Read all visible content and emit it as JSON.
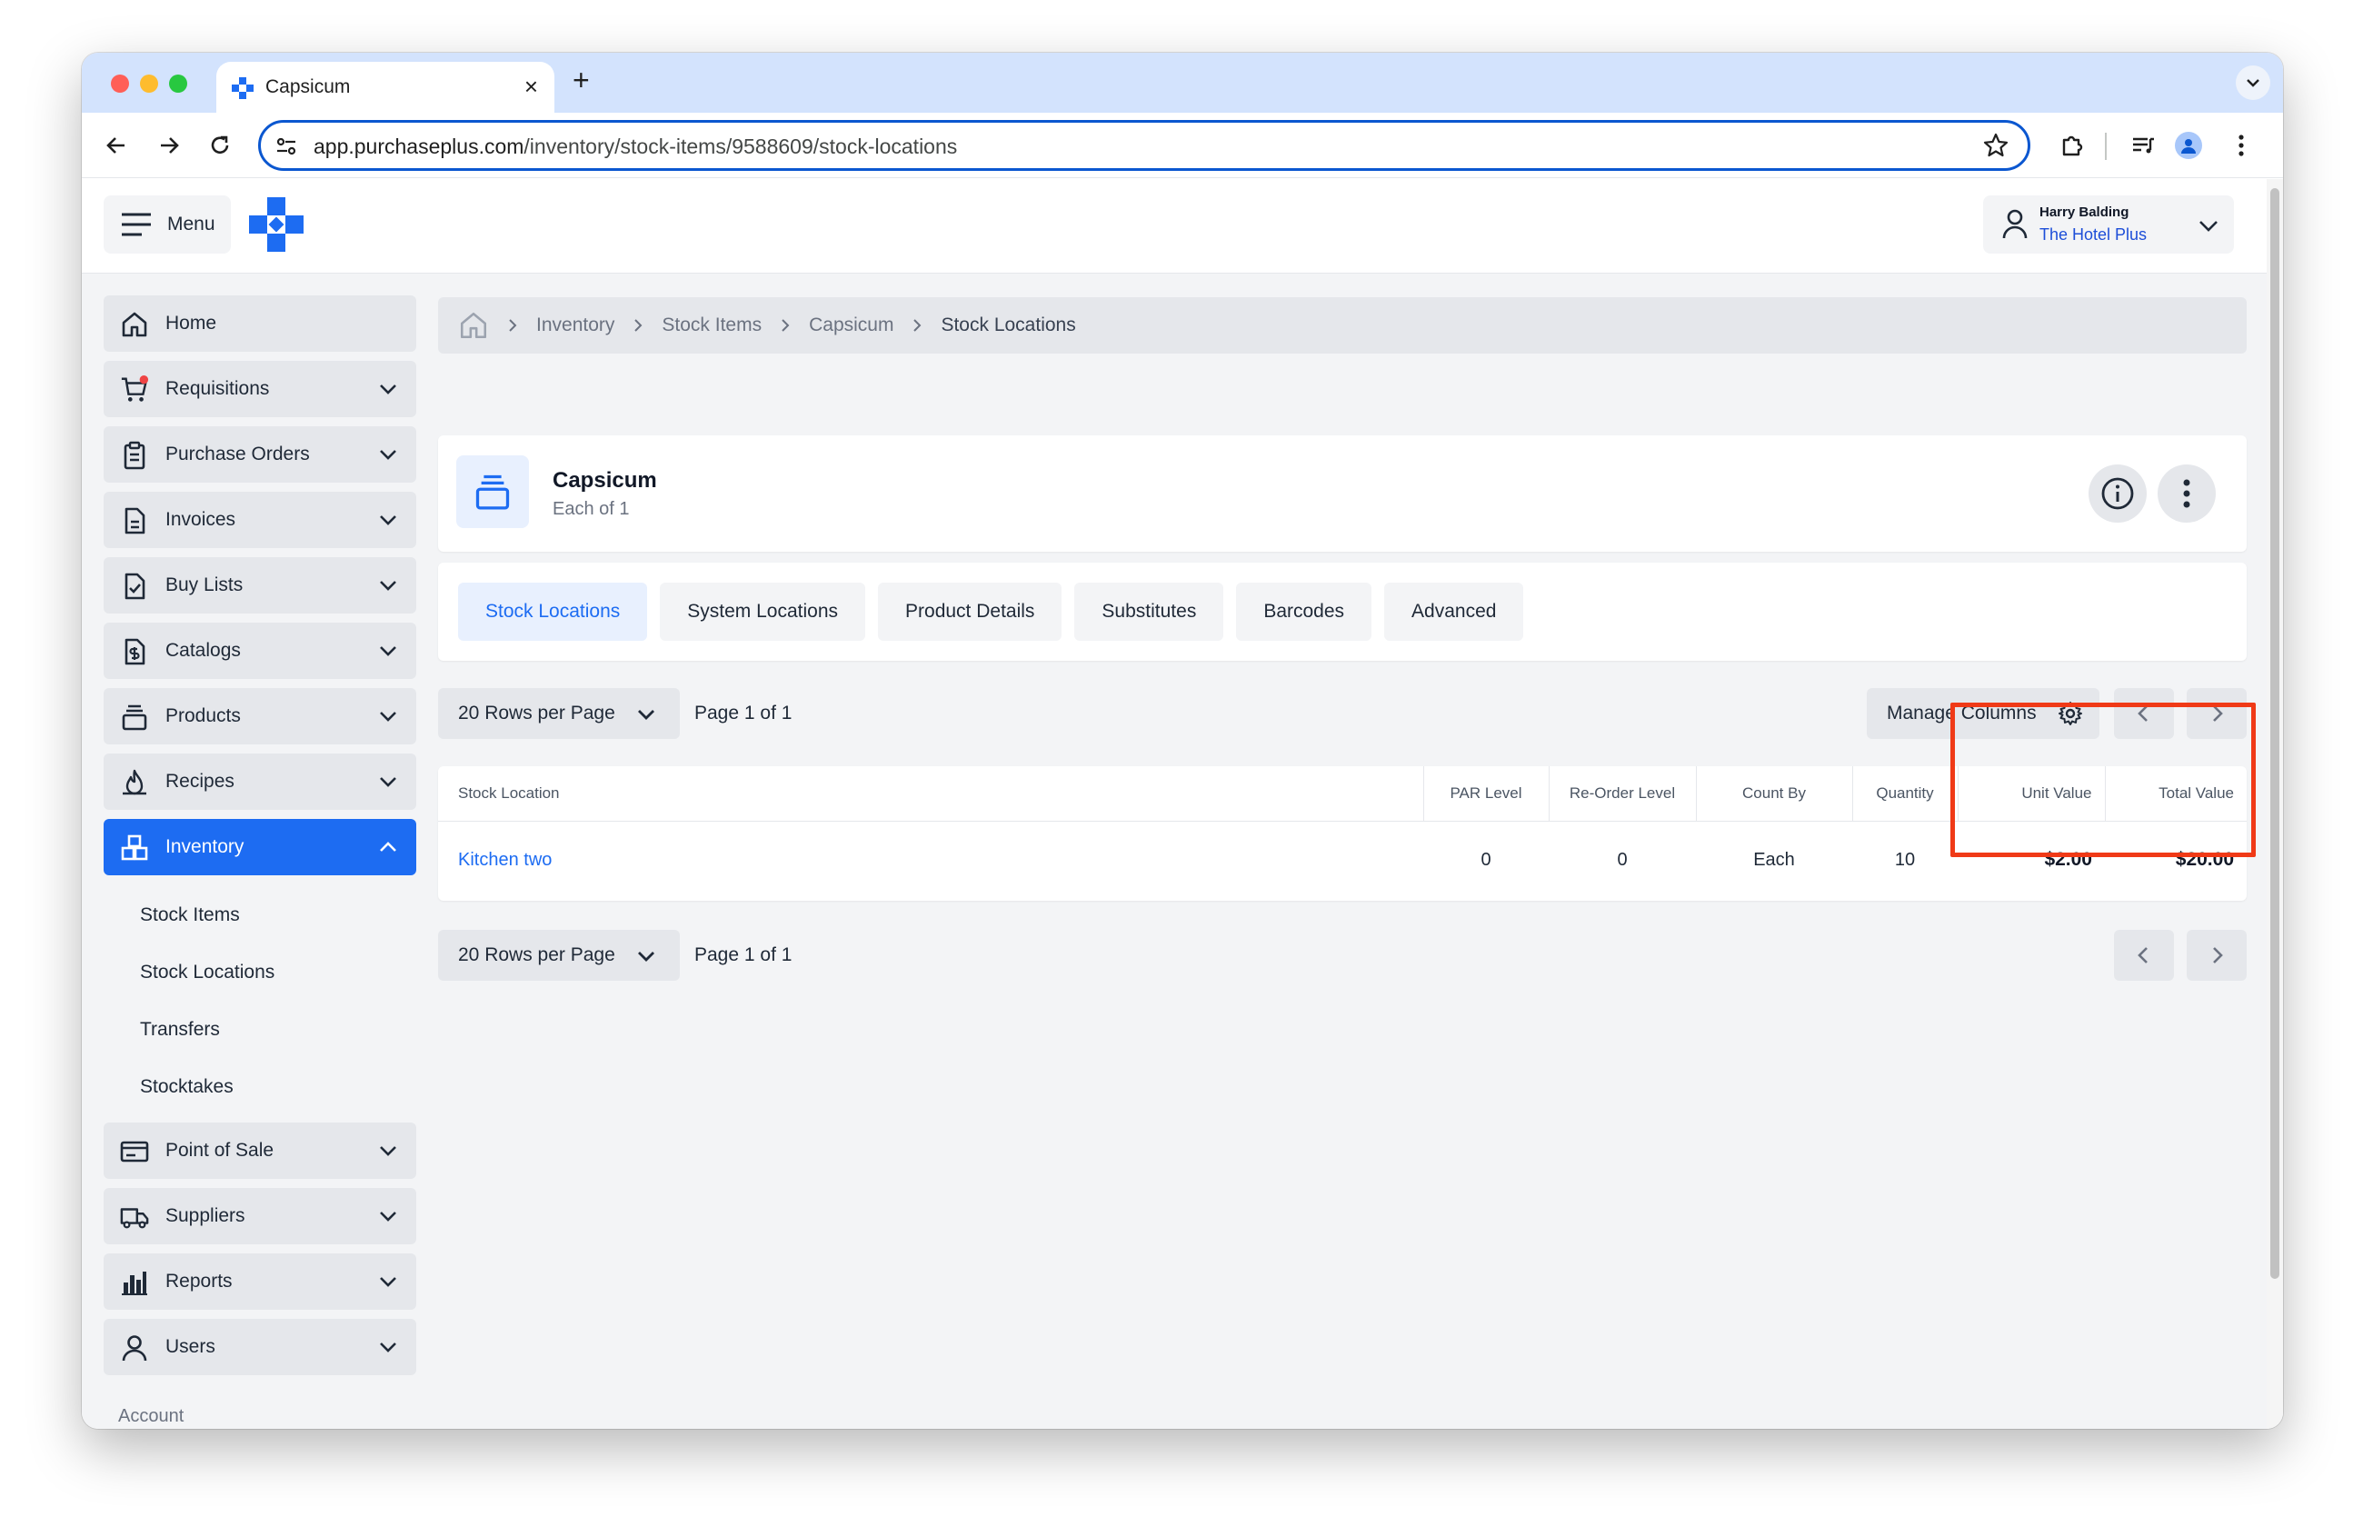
{
  "browser": {
    "tab_title": "Capsicum",
    "new_tab_symbol": "+",
    "close_symbol": "×",
    "url_host": "app.purchaseplus.com",
    "url_path": "/inventory/stock-items/9588609/stock-locations"
  },
  "header": {
    "menu_label": "Menu",
    "user_name": "Harry Balding",
    "user_org": "The Hotel Plus"
  },
  "sidebar": {
    "items": [
      {
        "label": "Home",
        "icon": "home-icon"
      },
      {
        "label": "Requisitions",
        "icon": "cart-icon"
      },
      {
        "label": "Purchase Orders",
        "icon": "clipboard-icon"
      },
      {
        "label": "Invoices",
        "icon": "document-icon"
      },
      {
        "label": "Buy Lists",
        "icon": "checklist-icon"
      },
      {
        "label": "Catalogs",
        "icon": "dollar-doc-icon"
      },
      {
        "label": "Products",
        "icon": "stack-icon"
      },
      {
        "label": "Recipes",
        "icon": "flame-icon"
      },
      {
        "label": "Inventory",
        "icon": "boxes-icon"
      },
      {
        "label": "Point of Sale",
        "icon": "card-icon"
      },
      {
        "label": "Suppliers",
        "icon": "truck-icon"
      },
      {
        "label": "Reports",
        "icon": "bar-chart-icon"
      },
      {
        "label": "Users",
        "icon": "user-icon"
      }
    ],
    "inventory_sub": [
      "Stock Items",
      "Stock Locations",
      "Transfers",
      "Stocktakes"
    ],
    "account_label": "Account"
  },
  "breadcrumb": [
    "Inventory",
    "Stock Items",
    "Capsicum",
    "Stock Locations"
  ],
  "item": {
    "name": "Capsicum",
    "unit": "Each of 1"
  },
  "tabs": [
    "Stock Locations",
    "System Locations",
    "Product Details",
    "Substitutes",
    "Barcodes",
    "Advanced"
  ],
  "pagination": {
    "rows_per_page": "20 Rows per Page",
    "page_text": "Page 1 of 1",
    "manage_columns": "Manage Columns"
  },
  "table": {
    "columns": [
      "Stock Location",
      "PAR Level",
      "Re-Order Level",
      "Count By",
      "Quantity",
      "Unit Value",
      "Total Value"
    ],
    "rows": [
      [
        "Kitchen two",
        "0",
        "0",
        "Each",
        "10",
        "$2.00",
        "$20.00"
      ]
    ]
  },
  "colors": {
    "accent": "#1d6cf2",
    "highlight": "#f03a17"
  }
}
